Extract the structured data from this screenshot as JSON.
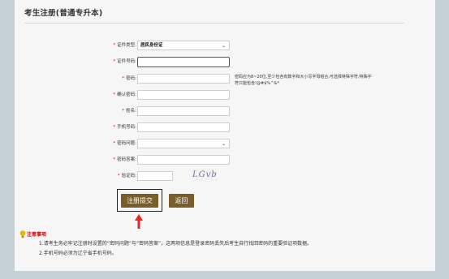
{
  "page": {
    "title": "考生注册(普通专升本)"
  },
  "form": {
    "fields": [
      {
        "label": "证件类型:",
        "type": "select",
        "value": "居民身份证"
      },
      {
        "label": "证件号码:",
        "type": "text",
        "value": ""
      },
      {
        "label": "密码:",
        "type": "password",
        "value": ""
      },
      {
        "label": "确认密码:",
        "type": "password",
        "value": ""
      },
      {
        "label": "姓名:",
        "type": "text",
        "value": ""
      },
      {
        "label": "手机号码:",
        "type": "text",
        "value": ""
      },
      {
        "label": "密码问题:",
        "type": "select",
        "value": ""
      },
      {
        "label": "密码答案:",
        "type": "text",
        "value": ""
      },
      {
        "label": "验证码:",
        "type": "text",
        "value": ""
      }
    ],
    "required_mark": "*",
    "password_hint": "密码应为8~20位,至少包含有数字和大小写字母组合,可选择特殊字符,特殊字符只能包含!@#$%^&*",
    "captcha_text": "LGvb",
    "submit_label": "注册提交",
    "back_label": "返回"
  },
  "notice": {
    "title": "注意事项",
    "lines": [
      "1.请考生务必牢记注册时设置的“密码问题”与“密码答案”，这两项信息是登录密码丢失后考生自行找回密码的重要验证项数据。",
      "2.手机号码必须为辽宁省手机号码。"
    ]
  },
  "colors": {
    "background": "#c5d1d6",
    "panel": "#f6f6f6",
    "required": "#e00000",
    "button": "#7a5e2a",
    "arrow": "#e8251f",
    "notice_title": "#d00000"
  }
}
